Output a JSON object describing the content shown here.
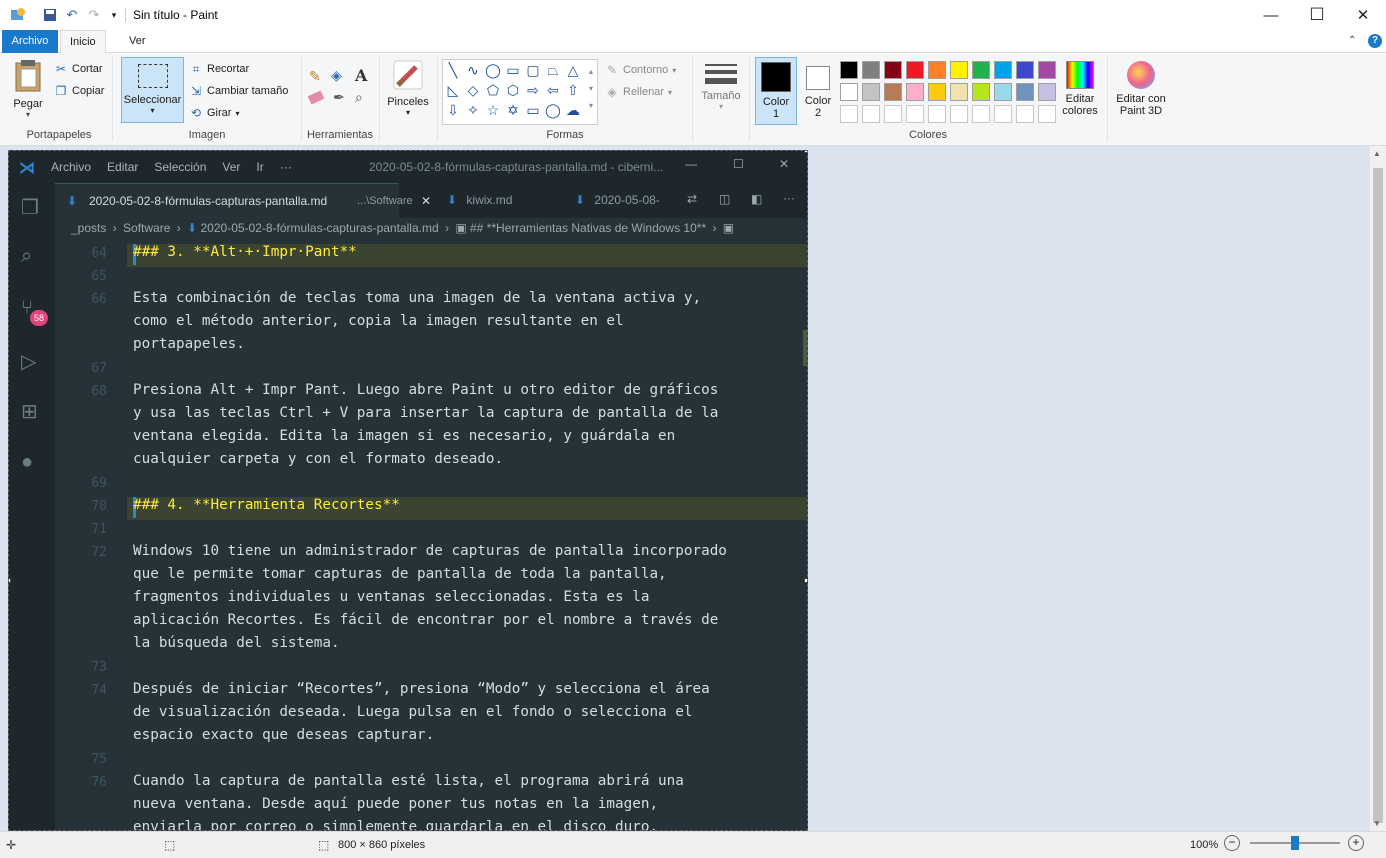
{
  "app": {
    "window_title": "Sin título - Paint",
    "window_controls": {
      "minimize": "—",
      "maximize": "☐",
      "close": "✕"
    }
  },
  "ribbon_tabs": [
    {
      "label": "Archivo"
    },
    {
      "label": "Inicio"
    },
    {
      "label": "Ver"
    }
  ],
  "ribbon": {
    "clipboard": {
      "paste": "Pegar",
      "cut": "Cortar",
      "copy": "Copiar",
      "group": "Portapapeles"
    },
    "image": {
      "select": "Seleccionar",
      "crop": "Recortar",
      "resize": "Cambiar tamaño",
      "rotate": "Girar",
      "group": "Imagen"
    },
    "tools": {
      "group": "Herramientas"
    },
    "brushes": {
      "label": "Pinceles"
    },
    "shapes": {
      "outline": "Contorno",
      "fill": "Rellenar",
      "group": "Formas"
    },
    "size": {
      "label": "Tamaño"
    },
    "colors": {
      "color1_line1": "Color",
      "color1_line2": "1",
      "color2_line1": "Color",
      "color2_line2": "2",
      "edit_line1": "Editar",
      "edit_line2": "colores",
      "paint3d_line1": "Editar con",
      "paint3d_line2": "Paint 3D",
      "group": "Colores",
      "color1": "#000000",
      "color2": "#ffffff",
      "palette_row1": [
        "#000000",
        "#7f7f7f",
        "#880015",
        "#ed1c24",
        "#ff7f27",
        "#fff200",
        "#22b14c",
        "#00a2e8",
        "#3f48cc",
        "#a349a4"
      ],
      "palette_row2": [
        "#ffffff",
        "#c3c3c3",
        "#b97a57",
        "#ffaec9",
        "#ffc90e",
        "#efe4b0",
        "#b5e61d",
        "#99d9ea",
        "#7092be",
        "#c8bfe7"
      ]
    }
  },
  "vscode": {
    "menu": [
      "Archivo",
      "Editar",
      "Selección",
      "Ver",
      "Ir",
      "···"
    ],
    "title": "2020-05-02-8-fórmulas-capturas-pantalla.md - ciberni...",
    "scm_badge": "58",
    "tabs": [
      {
        "name": "2020-05-02-8-fórmulas-capturas-pantalla.md",
        "path": "...\\Software"
      },
      {
        "name": "kiwix.md"
      },
      {
        "name": "2020-05-08-"
      }
    ],
    "breadcrumb": [
      "_posts",
      "Software",
      "2020-05-02-8-fórmulas-capturas-pantalla.md",
      "## **Herramientas Nativas de Windows 10**"
    ],
    "lines": [
      {
        "n": "64",
        "text": "### 3. **Alt·+·Impr·Pant**"
      },
      {
        "n": "65",
        "text": ""
      },
      {
        "n": "66",
        "text": "Esta combinación de teclas toma una imagen de la ventana activa y,"
      },
      {
        "n": "",
        "text": "como el método anterior, copia la imagen resultante en el"
      },
      {
        "n": "",
        "text": "portapapeles."
      },
      {
        "n": "67",
        "text": ""
      },
      {
        "n": "68",
        "text": "Presiona Alt + Impr Pant. Luego abre Paint u otro editor de gráficos"
      },
      {
        "n": "",
        "text": "y usa las teclas Ctrl + V para insertar la captura de pantalla de la"
      },
      {
        "n": "",
        "text": "ventana elegida. Edita la imagen si es necesario, y guárdala en"
      },
      {
        "n": "",
        "text": "cualquier carpeta y con el formato deseado."
      },
      {
        "n": "69",
        "text": ""
      },
      {
        "n": "70",
        "text": "### 4. **Herramienta Recortes**"
      },
      {
        "n": "71",
        "text": ""
      },
      {
        "n": "72",
        "text": "Windows 10 tiene un administrador de capturas de pantalla incorporado"
      },
      {
        "n": "",
        "text": "que le permite tomar capturas de pantalla de toda la pantalla,"
      },
      {
        "n": "",
        "text": "fragmentos individuales u ventanas seleccionadas. Esta es la"
      },
      {
        "n": "",
        "text": "aplicación Recortes. Es fácil de encontrar por el nombre a través de"
      },
      {
        "n": "",
        "text": "la búsqueda del sistema."
      },
      {
        "n": "73",
        "text": ""
      },
      {
        "n": "74",
        "text": "Después de iniciar “Recortes”, presiona “Modo” y selecciona el área"
      },
      {
        "n": "",
        "text": "de visualización deseada. Luega pulsa en el fondo o selecciona el"
      },
      {
        "n": "",
        "text": "espacio exacto que deseas capturar."
      },
      {
        "n": "75",
        "text": ""
      },
      {
        "n": "76",
        "text": "Cuando la captura de pantalla esté lista, el programa abrirá una"
      },
      {
        "n": "",
        "text": "nueva ventana. Desde aquí puede poner tus notas en la imagen,"
      },
      {
        "n": "",
        "text": "enviarla por correo o simplemente guardarla en el disco duro."
      }
    ]
  },
  "status": {
    "dimensions": "800 × 860 píxeles",
    "zoom": "100%",
    "zoom_level": 0.5
  }
}
